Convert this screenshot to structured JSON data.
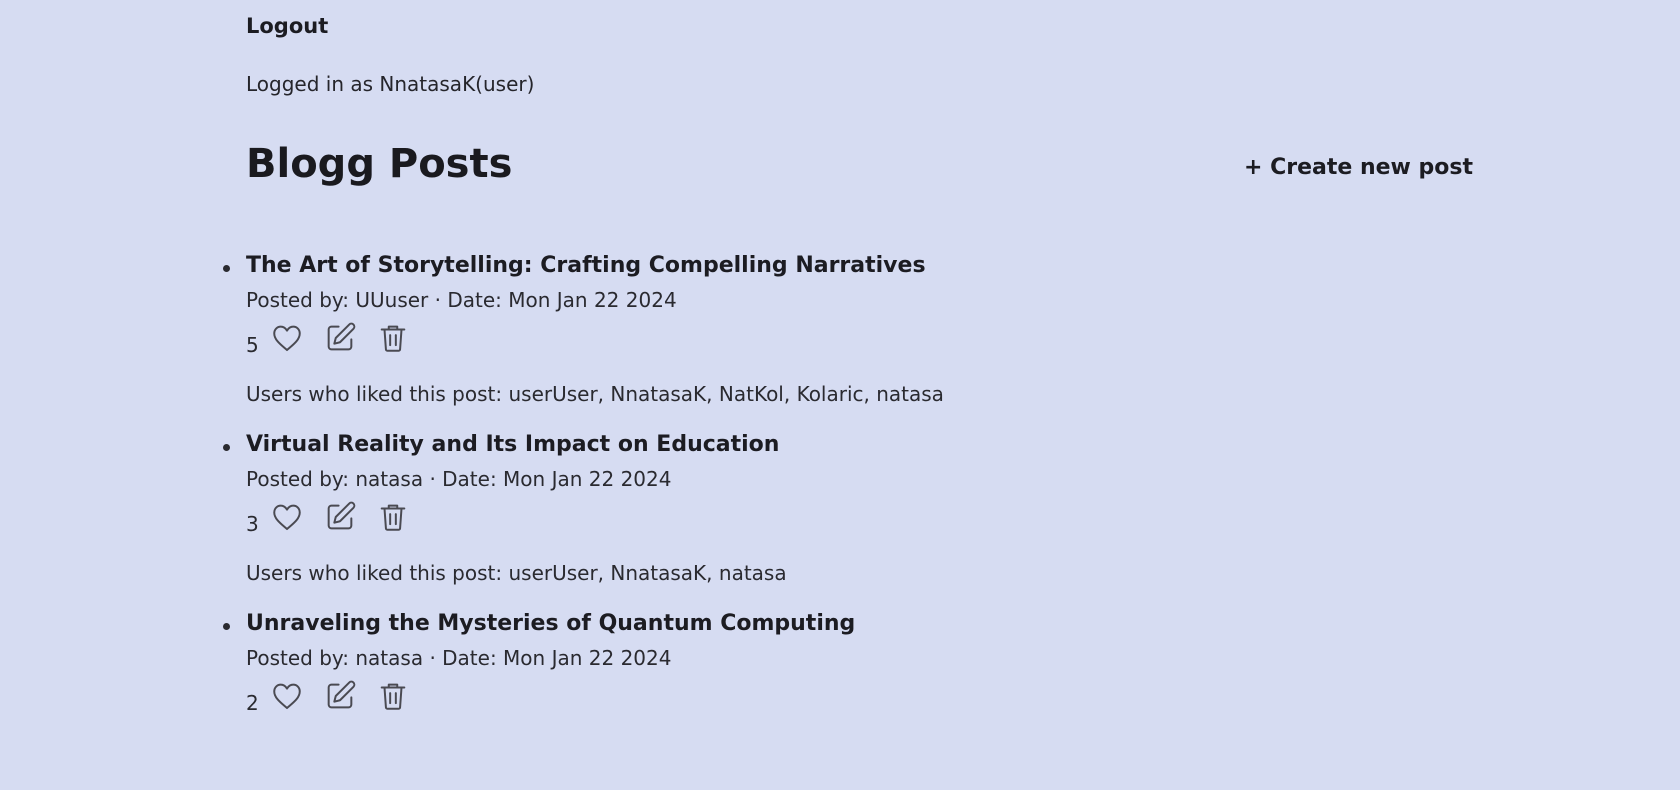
{
  "header": {
    "logout_label": "Logout",
    "logged_in_text": "Logged in as NnatasaK(user)"
  },
  "main": {
    "title": "Blogg Posts",
    "create_label": "+ Create new post"
  },
  "posts": [
    {
      "title": "The Art of Storytelling: Crafting Compelling Narratives",
      "meta": "Posted by: UUuser · Date: Mon Jan 22 2024",
      "likes": "5",
      "liked_by": "Users who liked this post: userUser, NnatasaK, NatKol, Kolaric, natasa"
    },
    {
      "title": "Virtual Reality and Its Impact on Education",
      "meta": "Posted by: natasa · Date: Mon Jan 22 2024",
      "likes": "3",
      "liked_by": "Users who liked this post: userUser, NnatasaK, natasa"
    },
    {
      "title": "Unraveling the Mysteries of Quantum Computing",
      "meta": "Posted by: natasa · Date: Mon Jan 22 2024",
      "likes": "2",
      "liked_by": ""
    }
  ],
  "icons": {
    "like": "heart-icon",
    "edit": "edit-icon",
    "delete": "trash-icon"
  },
  "colors": {
    "background": "#d6dcf2",
    "text": "#1f1f24",
    "icon": "#4a4a52"
  }
}
